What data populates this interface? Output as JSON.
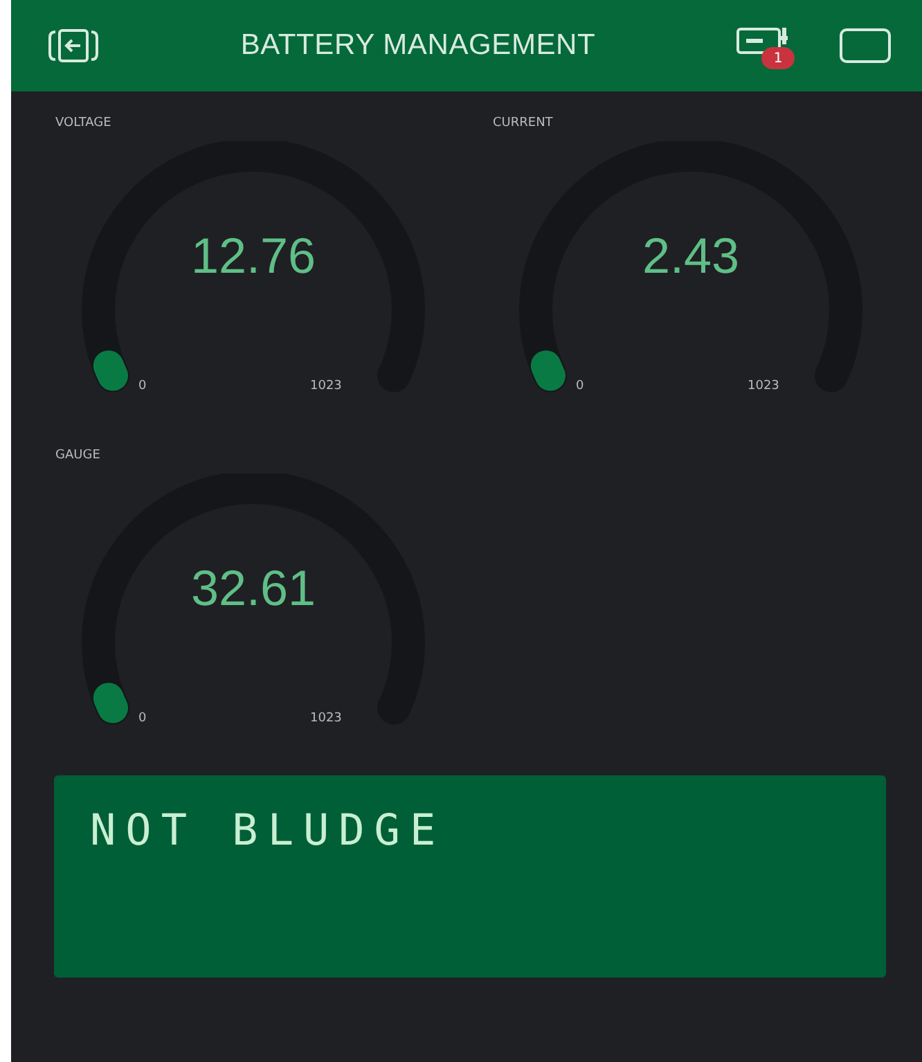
{
  "header": {
    "title": "BATTERY MANAGEMENT",
    "badge": "1"
  },
  "gauges": [
    {
      "label": "VOLTAGE",
      "value": "12.76",
      "min": "0",
      "max": "1023"
    },
    {
      "label": "CURRENT",
      "value": "2.43",
      "min": "0",
      "max": "1023"
    },
    {
      "label": "GAUGE",
      "value": "32.61",
      "min": "0",
      "max": "1023"
    }
  ],
  "lcd": {
    "lines": [
      "NOT BLUDGE"
    ]
  }
}
